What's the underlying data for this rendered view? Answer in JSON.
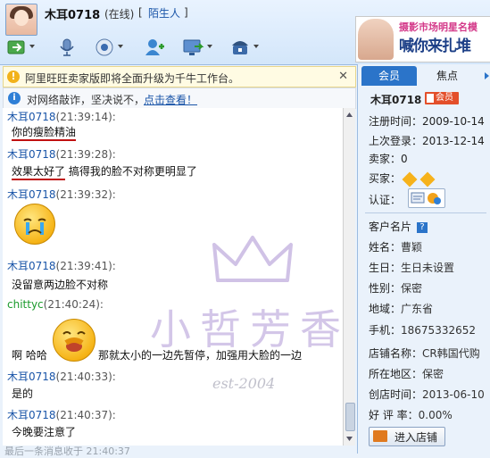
{
  "titlebar": {
    "name": "木耳0718",
    "status": "(在线)",
    "tag_open": "[",
    "tag": "陌生人",
    "tag_close": "]"
  },
  "toolbar": {
    "icons": [
      "send-file-icon",
      "microphone-icon",
      "camera-icon",
      "add-contact-icon",
      "screen-share-icon",
      "security-icon"
    ]
  },
  "ad": {
    "line1": "摄影市场明星名模",
    "line2": "喊你来扎堆",
    "highlight": "来"
  },
  "notices": {
    "upgrade": "阿里旺旺卖家版即将全面升级为千牛工作台。",
    "close": "✕",
    "fraud": "对网络敲诈，坚决说不，",
    "fraud_link": "点击查看！"
  },
  "chat": {
    "messages": [
      {
        "sender": "木耳0718",
        "time": "(21:39:14):",
        "text": "你的瘦脸精油"
      },
      {
        "sender": "木耳0718",
        "time": "(21:39:28):",
        "text_underlined": "效果太好了",
        "text": " 搞得我的脸不对称更明显了"
      },
      {
        "sender": "木耳0718",
        "time": "(21:39:32):",
        "emoji": "crying-emoji"
      },
      {
        "sender": "木耳0718",
        "time": "(21:39:41):",
        "text": "没留意两边脸不对称"
      },
      {
        "sender": "chittyc",
        "time": "(21:40:24):",
        "text_before": "啊 哈哈",
        "emoji": "laughing-emoji",
        "text": "那就太小的一边先暂停，加强用大脸的一边"
      },
      {
        "sender": "木耳0718",
        "time": "(21:40:33):",
        "text": "是的"
      },
      {
        "sender": "木耳0718",
        "time": "(21:40:37):",
        "text": "今晚要注意了"
      }
    ],
    "last_notice": "最后一条消息收于 21:40:37"
  },
  "watermark": {
    "text": "小哲芳香",
    "est": "est-2004"
  },
  "sidepanel": {
    "tabs": [
      "会员",
      "焦点"
    ],
    "name": "木耳0718",
    "badge": "会员",
    "register_label": "注册时间：",
    "register_value": "2009-10-14",
    "last_login_label": "上次登录：",
    "last_login_value": "2013-12-14",
    "seller_label": "卖家：",
    "seller_value": "0",
    "buyer_label": "买家：",
    "cert_label": "认证：",
    "card_title": "客户名片",
    "card_name_label": "姓名：",
    "card_name_value": "曹颖",
    "card_birthday_label": "生日：",
    "card_birthday_value": "生日未设置",
    "card_gender_label": "性别：",
    "card_gender_value": "保密",
    "card_region_label": "地域：",
    "card_region_value": "广东省",
    "card_phone_label": "手机：",
    "card_phone_value": "18675332652",
    "shop_name_label": "店铺名称：",
    "shop_name_value": "CR韩国代购",
    "shop_area_label": "所在地区：",
    "shop_area_value": "保密",
    "shop_created_label": "创店时间：",
    "shop_created_value": "2013-06-10",
    "rating_label": "好 评 率：",
    "rating_value": "0.00%",
    "enter_shop": "进入店铺"
  },
  "colors": {
    "accent": "#2b74c9",
    "link": "#1a55a8",
    "self_sender": "#1a9a2b",
    "underline": "#c01010",
    "badge": "#e34f2a"
  }
}
